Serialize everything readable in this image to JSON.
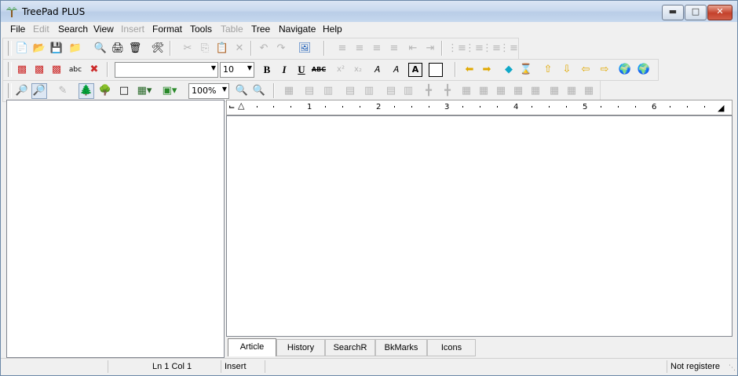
{
  "window": {
    "title": "TreePad PLUS"
  },
  "menu": [
    "File",
    "Edit",
    "Search",
    "View",
    "Insert",
    "Format",
    "Tools",
    "Table",
    "Tree",
    "Navigate",
    "Help"
  ],
  "format": {
    "font_name": "",
    "font_size": "10",
    "zoom": "100%"
  },
  "ruler": {
    "marks": [
      "1",
      "2",
      "3",
      "4",
      "5",
      "6"
    ]
  },
  "tabs": [
    "Article",
    "History",
    "SearchR",
    "BkMarks",
    "Icons"
  ],
  "status": {
    "position": "Ln 1  Col 1",
    "mode": "Insert",
    "registration": "Not registere"
  },
  "colors": {
    "accent_gold": "#e0a800",
    "accent_blue": "#1e5fb8",
    "accent_cyan": "#10a8c8",
    "accent_green": "#2a8a2a",
    "accent_red": "#cc2a2a"
  }
}
